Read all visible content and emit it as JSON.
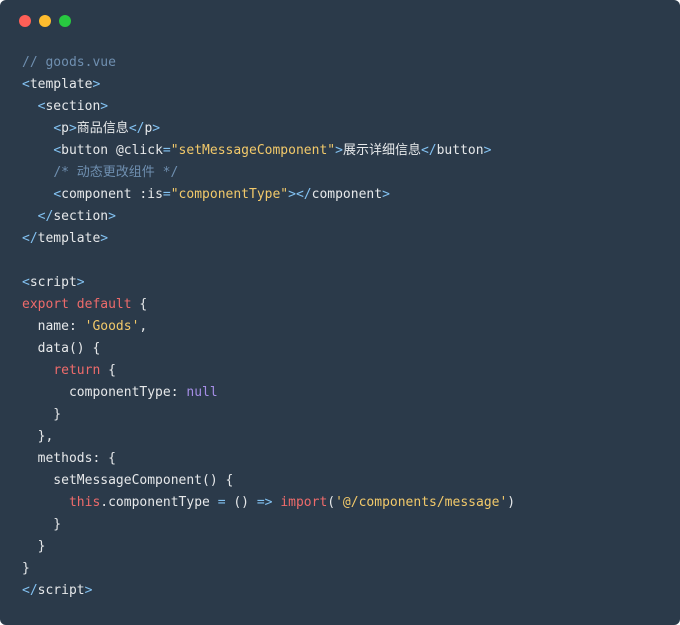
{
  "window": {
    "traffic_lights": [
      {
        "name": "close",
        "color": "#fe5f57"
      },
      {
        "name": "minimize",
        "color": "#febc2e"
      },
      {
        "name": "maximize",
        "color": "#28c840"
      }
    ]
  },
  "code": {
    "language": "vue",
    "lines": [
      [
        {
          "t": "comment",
          "v": "// goods.vue"
        }
      ],
      [
        {
          "t": "punct",
          "v": "<"
        },
        {
          "t": "tag",
          "v": "template"
        },
        {
          "t": "punct",
          "v": ">"
        }
      ],
      [
        {
          "t": "plain",
          "v": "  "
        },
        {
          "t": "punct",
          "v": "<"
        },
        {
          "t": "tag",
          "v": "section"
        },
        {
          "t": "punct",
          "v": ">"
        }
      ],
      [
        {
          "t": "plain",
          "v": "    "
        },
        {
          "t": "punct",
          "v": "<"
        },
        {
          "t": "tag",
          "v": "p"
        },
        {
          "t": "punct",
          "v": ">"
        },
        {
          "t": "plain",
          "v": "商品信息"
        },
        {
          "t": "punct",
          "v": "</"
        },
        {
          "t": "tag",
          "v": "p"
        },
        {
          "t": "punct",
          "v": ">"
        }
      ],
      [
        {
          "t": "plain",
          "v": "    "
        },
        {
          "t": "punct",
          "v": "<"
        },
        {
          "t": "tag",
          "v": "button "
        },
        {
          "t": "attr",
          "v": "@click"
        },
        {
          "t": "punct",
          "v": "="
        },
        {
          "t": "str",
          "v": "\"setMessageComponent\""
        },
        {
          "t": "punct",
          "v": ">"
        },
        {
          "t": "plain",
          "v": "展示详细信息"
        },
        {
          "t": "punct",
          "v": "</"
        },
        {
          "t": "tag",
          "v": "button"
        },
        {
          "t": "punct",
          "v": ">"
        }
      ],
      [
        {
          "t": "plain",
          "v": "    "
        },
        {
          "t": "comment",
          "v": "/* 动态更改组件 */"
        }
      ],
      [
        {
          "t": "plain",
          "v": "    "
        },
        {
          "t": "punct",
          "v": "<"
        },
        {
          "t": "tag",
          "v": "component "
        },
        {
          "t": "attr",
          "v": ":is"
        },
        {
          "t": "punct",
          "v": "="
        },
        {
          "t": "str",
          "v": "\"componentType\""
        },
        {
          "t": "punct",
          "v": "></"
        },
        {
          "t": "tag",
          "v": "component"
        },
        {
          "t": "punct",
          "v": ">"
        }
      ],
      [
        {
          "t": "plain",
          "v": "  "
        },
        {
          "t": "punct",
          "v": "</"
        },
        {
          "t": "tag",
          "v": "section"
        },
        {
          "t": "punct",
          "v": ">"
        }
      ],
      [
        {
          "t": "punct",
          "v": "</"
        },
        {
          "t": "tag",
          "v": "template"
        },
        {
          "t": "punct",
          "v": ">"
        }
      ],
      [
        {
          "t": "plain",
          "v": ""
        }
      ],
      [
        {
          "t": "punct",
          "v": "<"
        },
        {
          "t": "tag",
          "v": "script"
        },
        {
          "t": "punct",
          "v": ">"
        }
      ],
      [
        {
          "t": "kw",
          "v": "export"
        },
        {
          "t": "plain",
          "v": " "
        },
        {
          "t": "kw",
          "v": "default"
        },
        {
          "t": "plain",
          "v": " {"
        }
      ],
      [
        {
          "t": "plain",
          "v": "  name: "
        },
        {
          "t": "str",
          "v": "'Goods'"
        },
        {
          "t": "plain",
          "v": ","
        }
      ],
      [
        {
          "t": "plain",
          "v": "  data() {"
        }
      ],
      [
        {
          "t": "plain",
          "v": "    "
        },
        {
          "t": "kw",
          "v": "return"
        },
        {
          "t": "plain",
          "v": " {"
        }
      ],
      [
        {
          "t": "plain",
          "v": "      componentType: "
        },
        {
          "t": "null",
          "v": "null"
        }
      ],
      [
        {
          "t": "plain",
          "v": "    }"
        }
      ],
      [
        {
          "t": "plain",
          "v": "  },"
        }
      ],
      [
        {
          "t": "plain",
          "v": "  methods: {"
        }
      ],
      [
        {
          "t": "plain",
          "v": "    setMessageComponent() {"
        }
      ],
      [
        {
          "t": "plain",
          "v": "      "
        },
        {
          "t": "kw",
          "v": "this"
        },
        {
          "t": "plain",
          "v": ".componentType "
        },
        {
          "t": "punct",
          "v": "="
        },
        {
          "t": "plain",
          "v": " () "
        },
        {
          "t": "punct",
          "v": "=>"
        },
        {
          "t": "plain",
          "v": " "
        },
        {
          "t": "kw",
          "v": "import"
        },
        {
          "t": "plain",
          "v": "("
        },
        {
          "t": "str",
          "v": "'@/components/message'"
        },
        {
          "t": "plain",
          "v": ")"
        }
      ],
      [
        {
          "t": "plain",
          "v": "    }"
        }
      ],
      [
        {
          "t": "plain",
          "v": "  }"
        }
      ],
      [
        {
          "t": "plain",
          "v": "}"
        }
      ],
      [
        {
          "t": "punct",
          "v": "</"
        },
        {
          "t": "tag",
          "v": "script"
        },
        {
          "t": "punct",
          "v": ">"
        }
      ]
    ]
  }
}
